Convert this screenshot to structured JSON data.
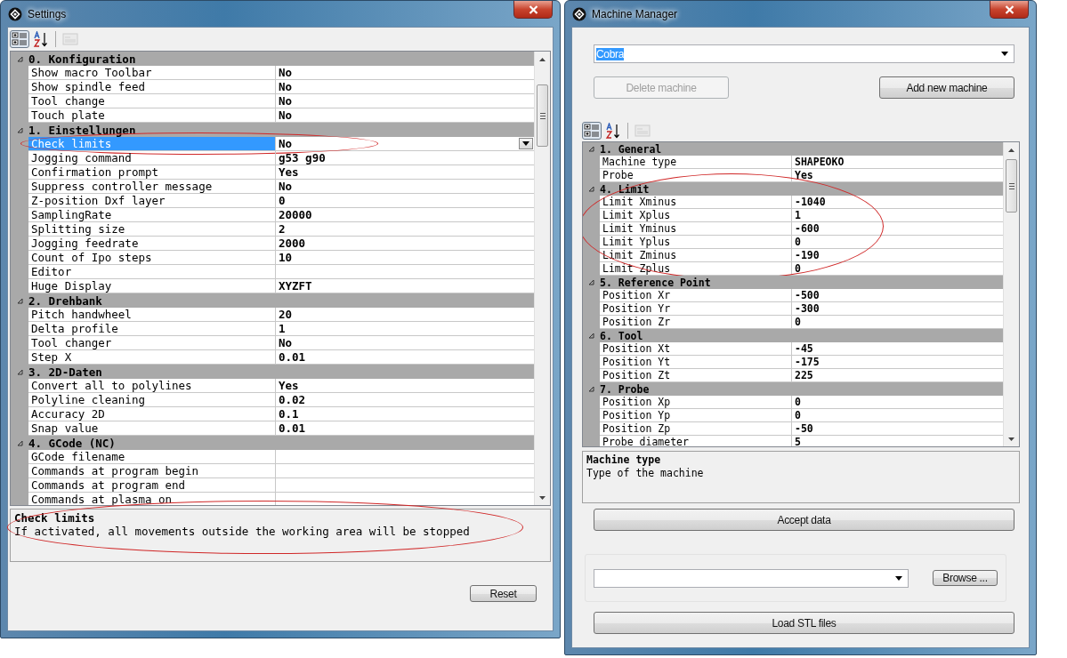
{
  "settings_window": {
    "title": "Settings",
    "toolbar": [
      {
        "kind": "categorized",
        "selected": true,
        "disabled": false
      },
      {
        "kind": "alphabetical",
        "selected": false,
        "disabled": false
      },
      {
        "kind": "pages",
        "selected": false,
        "disabled": true
      }
    ],
    "grid": {
      "categories": [
        {
          "name": "0. Konfiguration",
          "expanded": true,
          "circled": false,
          "properties": [
            {
              "name": "Show macro Toolbar",
              "value": "No",
              "selected": false,
              "circled": false
            },
            {
              "name": "Show spindle feed",
              "value": "No",
              "selected": false,
              "circled": false
            },
            {
              "name": "Tool change",
              "value": "No",
              "selected": false,
              "circled": false
            },
            {
              "name": "Touch plate",
              "value": "No",
              "selected": false,
              "circled": false
            }
          ]
        },
        {
          "name": "1. Einstellungen",
          "expanded": true,
          "circled": false,
          "properties": [
            {
              "name": "Check limits",
              "value": "No",
              "selected": true,
              "circled": true
            },
            {
              "name": "Jogging command",
              "value": "g53 g90",
              "selected": false,
              "circled": false
            },
            {
              "name": "Confirmation prompt",
              "value": "Yes",
              "selected": false,
              "circled": false
            },
            {
              "name": "Suppress controller message",
              "value": "No",
              "selected": false,
              "circled": false
            },
            {
              "name": "Z-position Dxf layer",
              "value": "0",
              "selected": false,
              "circled": false
            },
            {
              "name": "SamplingRate",
              "value": "20000",
              "selected": false,
              "circled": false
            },
            {
              "name": "Splitting size",
              "value": "2",
              "selected": false,
              "circled": false
            },
            {
              "name": "Jogging feedrate",
              "value": "2000",
              "selected": false,
              "circled": false
            },
            {
              "name": "Count of Ipo steps",
              "value": "10",
              "selected": false,
              "circled": false
            },
            {
              "name": "Editor",
              "selected": false,
              "circled": false
            },
            {
              "name": "Huge Display",
              "value": "XYZFT",
              "selected": false,
              "circled": false
            }
          ]
        },
        {
          "name": "2. Drehbank",
          "expanded": true,
          "circled": false,
          "properties": [
            {
              "name": "Pitch handwheel",
              "value": "20",
              "selected": false,
              "circled": false
            },
            {
              "name": "Delta profile",
              "value": "1",
              "selected": false,
              "circled": false
            },
            {
              "name": "Tool changer",
              "value": "No",
              "selected": false,
              "circled": false
            },
            {
              "name": "Step X",
              "value": "0.01",
              "selected": false,
              "circled": false
            }
          ]
        },
        {
          "name": "3. 2D-Daten",
          "expanded": true,
          "circled": false,
          "properties": [
            {
              "name": "Convert all to polylines",
              "value": "Yes",
              "selected": false,
              "circled": false
            },
            {
              "name": "Polyline cleaning",
              "value": "0.02",
              "selected": false,
              "circled": false
            },
            {
              "name": "Accuracy 2D",
              "value": "0.1",
              "selected": false,
              "circled": false
            },
            {
              "name": "Snap value",
              "value": "0.01",
              "selected": false,
              "circled": false
            }
          ]
        },
        {
          "name": "4. GCode (NC)",
          "expanded": true,
          "circled": false,
          "properties": [
            {
              "name": "GCode filename",
              "selected": false,
              "circled": false
            },
            {
              "name": "Commands at program begin",
              "selected": false,
              "circled": false
            },
            {
              "name": "Commands at program end",
              "selected": false,
              "circled": false
            },
            {
              "name": "Commands at plasma on",
              "selected": false,
              "circled": false
            }
          ]
        }
      ]
    },
    "description": {
      "title": "Check limits",
      "text": "If activated, all movements outside the working area will be stopped",
      "circled": true
    },
    "buttons": [
      {
        "label": "Reset",
        "disabled": false
      }
    ]
  },
  "machine_window": {
    "title": "Machine Manager",
    "machine_combo": {
      "value": "Cobra",
      "text_selected": true
    },
    "buttons": [
      {
        "label": "Delete machine",
        "disabled": true
      },
      {
        "label": "Add new machine",
        "disabled": false
      }
    ],
    "toolbar": [
      {
        "kind": "categorized",
        "selected": true,
        "disabled": false
      },
      {
        "kind": "alphabetical",
        "selected": false,
        "disabled": false
      },
      {
        "kind": "pages",
        "selected": false,
        "disabled": true
      }
    ],
    "grid": {
      "categories": [
        {
          "name": "1. General",
          "expanded": true,
          "circled": false,
          "properties": [
            {
              "name": "Machine type",
              "value": "SHAPEOKO",
              "selected": false,
              "circled": false
            },
            {
              "name": "Probe",
              "value": "Yes",
              "selected": false,
              "circled": false
            }
          ]
        },
        {
          "name": "4. Limit",
          "expanded": true,
          "circled": true,
          "properties": [
            {
              "name": "Limit Xminus",
              "value": "-1040",
              "selected": false,
              "circled": false
            },
            {
              "name": "Limit Xplus",
              "value": "1",
              "selected": false,
              "circled": false
            },
            {
              "name": "Limit Yminus",
              "value": "-600",
              "selected": false,
              "circled": false
            },
            {
              "name": "Limit Yplus",
              "value": "0",
              "selected": false,
              "circled": false
            },
            {
              "name": "Limit Zminus",
              "value": "-190",
              "selected": false,
              "circled": false
            },
            {
              "name": "Limit Zplus",
              "value": "0",
              "selected": false,
              "circled": false
            }
          ]
        },
        {
          "name": "5. Reference Point",
          "expanded": true,
          "circled": false,
          "properties": [
            {
              "name": "Position Xr",
              "value": "-500",
              "selected": false,
              "circled": false
            },
            {
              "name": "Position Yr",
              "value": "-300",
              "selected": false,
              "circled": false
            },
            {
              "name": "Position Zr",
              "value": "0",
              "selected": false,
              "circled": false
            }
          ]
        },
        {
          "name": "6. Tool",
          "expanded": true,
          "circled": false,
          "properties": [
            {
              "name": "Position Xt",
              "value": "-45",
              "selected": false,
              "circled": false
            },
            {
              "name": "Position Yt",
              "value": "-175",
              "selected": false,
              "circled": false
            },
            {
              "name": "Position Zt",
              "value": "225",
              "selected": false,
              "circled": false
            }
          ]
        },
        {
          "name": "7. Probe",
          "expanded": true,
          "circled": false,
          "properties": [
            {
              "name": "Position Xp",
              "value": "0",
              "selected": false,
              "circled": false
            },
            {
              "name": "Position Yp",
              "value": "0",
              "selected": false,
              "circled": false
            },
            {
              "name": "Position Zp",
              "value": "-50",
              "selected": false,
              "circled": false
            },
            {
              "name": "Probe diameter",
              "value": "5",
              "selected": false,
              "circled": false
            }
          ]
        }
      ]
    },
    "description": {
      "title": "Machine type",
      "text": "Type of the machine",
      "circled": false
    },
    "accept_button": {
      "label": "Accept data",
      "disabled": false
    },
    "browse_button": {
      "label": "Browse ...",
      "disabled": false
    },
    "load_button": {
      "label": "Load STL files",
      "disabled": false
    }
  }
}
